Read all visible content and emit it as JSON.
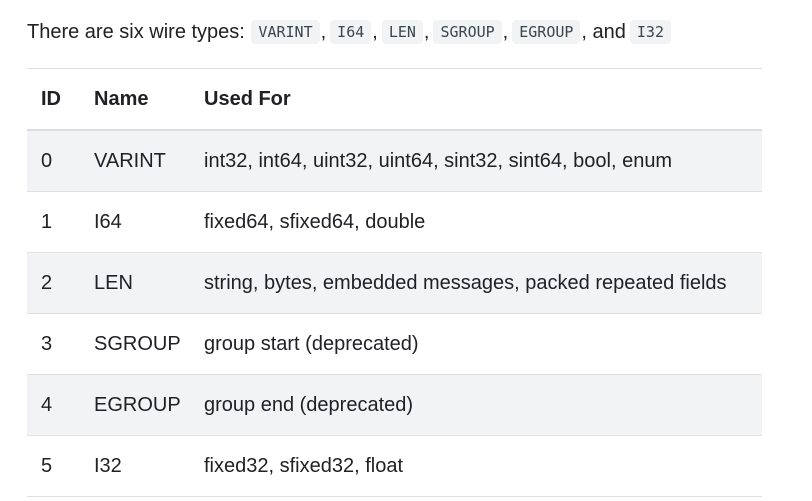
{
  "intro": {
    "prefix": "There are six wire types:",
    "types": [
      "VARINT",
      "I64",
      "LEN",
      "SGROUP",
      "EGROUP",
      "I32"
    ],
    "comma": ",",
    "and_text": ", and"
  },
  "table": {
    "headers": {
      "id": "ID",
      "name": "Name",
      "used_for": "Used For"
    },
    "rows": [
      {
        "id": "0",
        "name": "VARINT",
        "used_for": "int32, int64, uint32, uint64, sint32, sint64, bool, enum"
      },
      {
        "id": "1",
        "name": "I64",
        "used_for": "fixed64, sfixed64, double"
      },
      {
        "id": "2",
        "name": "LEN",
        "used_for": "string, bytes, embedded messages, packed repeated fields"
      },
      {
        "id": "3",
        "name": "SGROUP",
        "used_for": "group start (deprecated)"
      },
      {
        "id": "4",
        "name": "EGROUP",
        "used_for": "group end (deprecated)"
      },
      {
        "id": "5",
        "name": "I32",
        "used_for": "fixed32, sfixed32, float"
      }
    ]
  }
}
